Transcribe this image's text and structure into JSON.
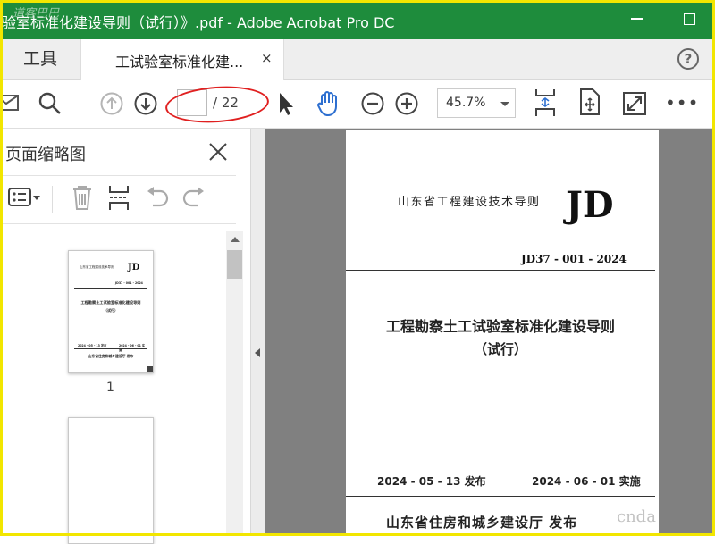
{
  "window": {
    "title": "验室标准化建设导则（试行）》.pdf - Adobe Acrobat Pro DC",
    "watermark": "道客巴巴"
  },
  "tabs": {
    "tools_label": "工具",
    "doc_label": "工试验室标准化建...",
    "close_glyph": "×",
    "help_glyph": "?"
  },
  "toolbar": {
    "current_page": "",
    "page_total": "/ 22",
    "zoom": "45.7%",
    "more_glyph": "•••"
  },
  "panel": {
    "title": "页面缩略图",
    "thumb_page_label": "1"
  },
  "thumbnail": {
    "org": "山东省工程建设技术导则",
    "jd": "JD",
    "code": "JD37 - 001 - 2024",
    "main_title": "工程勘察土工试验室标准化建设导则",
    "subtitle": "（试行）",
    "date_publish": "2024 - 05 - 13 发布",
    "date_effective": "2024 - 06 - 01 实施",
    "publisher": "山东省住房和城乡建设厅 发布"
  },
  "document": {
    "org": "山东省工程建设技术导则",
    "jd": "JD",
    "code": "JD37 - 001 - 2024",
    "main_title": "工程勘察土工试验室标准化建设导则",
    "subtitle": "（试行）",
    "date_publish": "2024 - 05 - 13 发布",
    "date_effective": "2024 - 06 - 01 实施",
    "publisher": "山东省住房和城乡建设厅 发布",
    "watermark": "cnda"
  },
  "colors": {
    "titlebar_bg": "#1e8c3c",
    "frame": "#f2e600",
    "annotation": "#e02020",
    "hand_tool": "#2d6fd0",
    "doc_bg": "#808080"
  },
  "icons": [
    "mail-icon",
    "search-icon",
    "prev-page-icon",
    "next-page-icon",
    "select-cursor-icon",
    "hand-tool-icon",
    "zoom-out-icon",
    "zoom-in-icon",
    "fit-page-icon",
    "scroll-mode-icon",
    "fullscreen-icon",
    "more-icon",
    "close-icon",
    "options-menu-icon",
    "trash-icon",
    "insert-pages-icon",
    "undo-icon",
    "redo-icon"
  ]
}
